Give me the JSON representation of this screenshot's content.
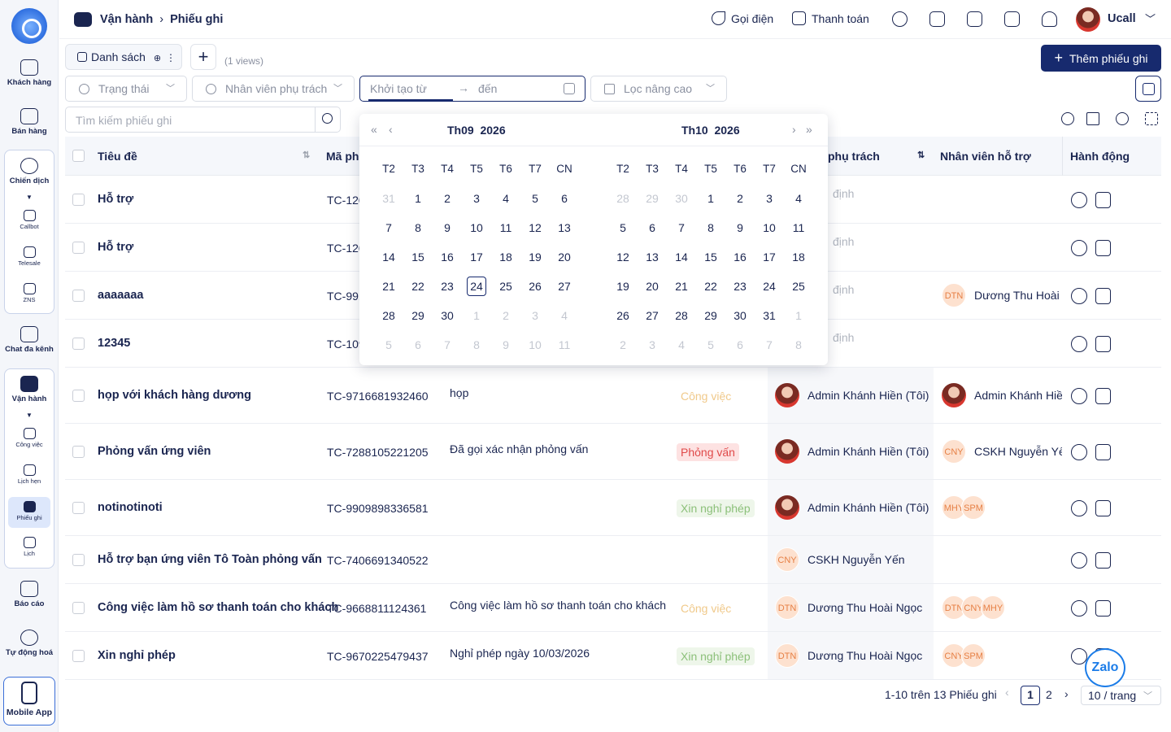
{
  "sidebar": {
    "items": [
      {
        "label": "Khách hàng",
        "icon": "contact-card-icon"
      },
      {
        "label": "Bán hàng",
        "icon": "shop-icon"
      },
      {
        "label": "Chiến dịch",
        "icon": "target-icon"
      },
      {
        "label": "Chat đa kênh",
        "icon": "chat-icon"
      },
      {
        "label": "Vận hành",
        "icon": "briefcase-icon"
      },
      {
        "label": "Báo cáo",
        "icon": "chart-icon"
      },
      {
        "label": "Tự động hoá",
        "icon": "automation-icon"
      }
    ],
    "campaign_sub": [
      "Callbot",
      "Telesale",
      "ZNS"
    ],
    "ops_sub": [
      "Công việc",
      "Lịch hẹn",
      "Phiếu ghi",
      "Lịch"
    ],
    "mobile_label": "Mobile App"
  },
  "topbar": {
    "breadcrumb": [
      "Vận hành",
      "Phiếu ghi"
    ],
    "call_label": "Gọi điện",
    "pay_label": "Thanh toán",
    "username": "Ucall"
  },
  "toolbar": {
    "tab_label": "Danh sách",
    "views_label": "(1 views)",
    "add_button": "Thêm phiếu ghi",
    "filter_status": "Trạng thái",
    "filter_owner": "Nhân viên phụ trách",
    "date_from_placeholder": "Khởi tạo từ",
    "date_to_placeholder": "đến",
    "filter_advanced": "Lọc nâng cao",
    "search_placeholder": "Tìm kiếm phiếu ghi"
  },
  "table": {
    "headers": {
      "title": "Tiêu đề",
      "code": "Mã phi",
      "owner": "phụ trách",
      "support": "Nhân viên hỗ trợ",
      "action": "Hành động"
    },
    "rows": [
      {
        "title": "Hỗ trợ",
        "code": "TC-120",
        "desc": "",
        "type": "",
        "owner": "định",
        "support": ""
      },
      {
        "title": "Hỗ trợ",
        "code": "TC-120",
        "desc": "",
        "type": "",
        "owner": "định",
        "support": ""
      },
      {
        "title": "aaaaaaa",
        "code": "TC-991",
        "desc": "",
        "type": "",
        "owner": "định",
        "support": "Dương Thu Hoài N",
        "support_initials": [
          "DTN"
        ]
      },
      {
        "title": "12345",
        "code": "TC-109",
        "desc": "",
        "type": "",
        "owner": "định",
        "support": ""
      },
      {
        "title": "họp với khách hàng dương",
        "code": "TC-9716681932460",
        "desc": "họp",
        "type": "Công việc",
        "owner": "Admin Khánh Hiền (Tôi)",
        "support": "Admin Khánh Hiền"
      },
      {
        "title": "Phỏng vấn ứng viên",
        "code": "TC-7288105221205",
        "desc": "Đã gọi xác nhận phỏng vấn",
        "type": "Phỏng vấn",
        "owner": "Admin Khánh Hiền (Tôi)",
        "support": "CSKH Nguyễn Yến",
        "support_initials": [
          "CNY"
        ]
      },
      {
        "title": "notinotinoti",
        "code": "TC-9909898336581",
        "desc": "",
        "type": "Xin nghỉ phép",
        "owner": "Admin Khánh Hiền (Tôi)",
        "support": "",
        "support_initials": [
          "MHY",
          "SPM"
        ]
      },
      {
        "title": "Hỗ trợ bạn ứng viên Tô Toàn phỏng vấn",
        "code": "TC-7406691340522",
        "desc": "",
        "type": "",
        "owner": "CSKH Nguyễn Yến",
        "owner_initials": "CNY",
        "support": ""
      },
      {
        "title": "Công việc làm hồ sơ thanh toán cho khách",
        "code": "TC-9668811124361",
        "desc": "Công việc làm hồ sơ thanh toán cho khách",
        "type": "Công việc",
        "owner": "Dương Thu Hoài Ngọc",
        "owner_initials": "DTN",
        "support": "",
        "support_initials": [
          "DTN",
          "CNY",
          "MHY"
        ]
      },
      {
        "title": "Xin nghỉ phép",
        "code": "TC-9670225479437",
        "desc": "Nghỉ phép ngày 10/03/2026",
        "type": "Xin nghỉ phép",
        "owner": "Dương Thu Hoài Ngọc",
        "owner_initials": "DTN",
        "support": "",
        "support_initials": [
          "CNY",
          "SPM"
        ]
      }
    ]
  },
  "calendar": {
    "left_month": "Th09",
    "left_year": "2026",
    "right_month": "Th10",
    "right_year": "2026",
    "weekdays": [
      "T2",
      "T3",
      "T4",
      "T5",
      "T6",
      "T7",
      "CN"
    ],
    "today": "24",
    "left_days": [
      "31",
      "1",
      "2",
      "3",
      "4",
      "5",
      "6",
      "7",
      "8",
      "9",
      "10",
      "11",
      "12",
      "13",
      "14",
      "15",
      "16",
      "17",
      "18",
      "19",
      "20",
      "21",
      "22",
      "23",
      "24",
      "25",
      "26",
      "27",
      "28",
      "29",
      "30",
      "1",
      "2",
      "3",
      "4",
      "5",
      "6",
      "7",
      "8",
      "9",
      "10",
      "11"
    ],
    "right_days": [
      "28",
      "29",
      "30",
      "1",
      "2",
      "3",
      "4",
      "5",
      "6",
      "7",
      "8",
      "9",
      "10",
      "11",
      "12",
      "13",
      "14",
      "15",
      "16",
      "17",
      "18",
      "19",
      "20",
      "21",
      "22",
      "23",
      "24",
      "25",
      "26",
      "27",
      "28",
      "29",
      "30",
      "31",
      "1",
      "2",
      "3",
      "4",
      "5",
      "6",
      "7",
      "8"
    ]
  },
  "pagination": {
    "info": "1-10 trên 13 Phiếu ghi",
    "pages": [
      "1",
      "2"
    ],
    "current": "1",
    "page_size": "10 / trang"
  },
  "chat_widget": "Zalo",
  "colors": {
    "primary": "#172a6e",
    "work_tag": "#f3d7a0",
    "interview_tag_bg": "#fde2e2",
    "interview_tag_fg": "#e04a4a",
    "leave_tag_bg": "#eef6ea",
    "leave_tag_fg": "#8cc07a",
    "avatar_bg": "#fde1cf",
    "avatar_fg": "#e67f44"
  }
}
